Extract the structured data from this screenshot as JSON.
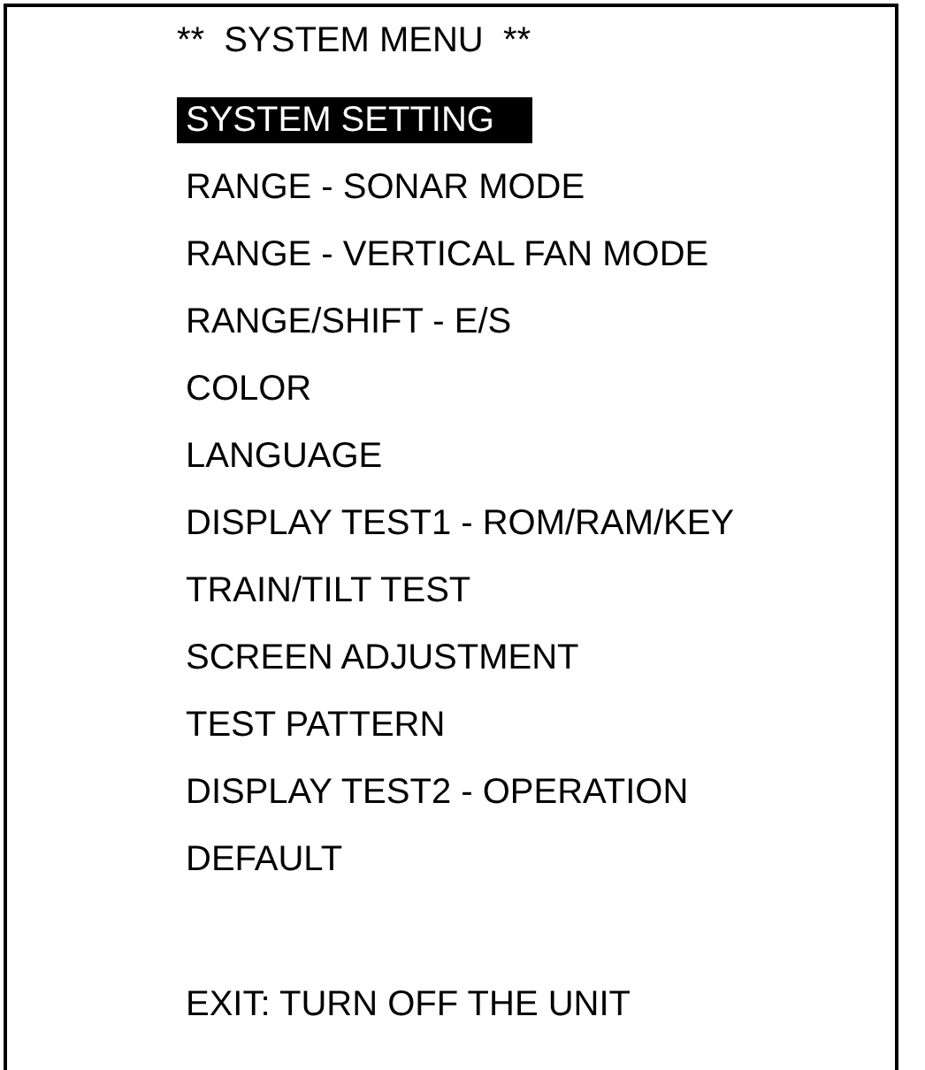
{
  "menu": {
    "title": "**  SYSTEM MENU  **",
    "items": [
      {
        "label": "SYSTEM SETTING",
        "selected": true
      },
      {
        "label": "RANGE - SONAR MODE",
        "selected": false
      },
      {
        "label": "RANGE - VERTICAL FAN MODE",
        "selected": false
      },
      {
        "label": "RANGE/SHIFT - E/S",
        "selected": false
      },
      {
        "label": "COLOR",
        "selected": false
      },
      {
        "label": "LANGUAGE",
        "selected": false
      },
      {
        "label": "DISPLAY TEST1 - ROM/RAM/KEY",
        "selected": false
      },
      {
        "label": "TRAIN/TILT TEST",
        "selected": false
      },
      {
        "label": "SCREEN ADJUSTMENT",
        "selected": false
      },
      {
        "label": "TEST PATTERN",
        "selected": false
      },
      {
        "label": "DISPLAY TEST2 - OPERATION",
        "selected": false
      },
      {
        "label": "DEFAULT",
        "selected": false
      }
    ],
    "footer": "EXIT: TURN OFF THE UNIT"
  }
}
